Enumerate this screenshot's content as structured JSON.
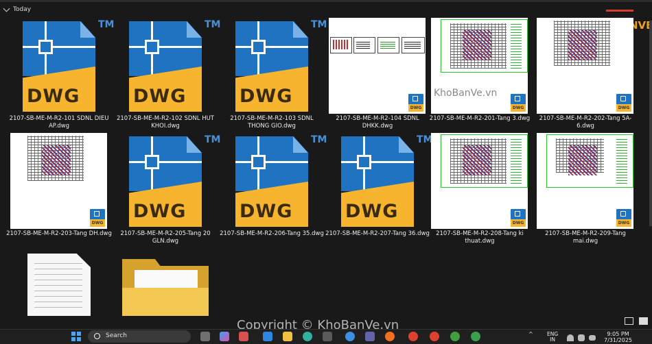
{
  "group": {
    "label": "Today"
  },
  "files": [
    {
      "name": "2107-SB-ME-M-R2-101 SDNL DIEU AP.dwg",
      "thumb": "dwg-icon"
    },
    {
      "name": "2107-SB-ME-M-R2-102 SDNL HUT KHOI.dwg",
      "thumb": "dwg-icon"
    },
    {
      "name": "2107-SB-ME-M-R2-103 SDNL THONG GIO.dwg",
      "thumb": "dwg-icon"
    },
    {
      "name": "2107-SB-ME-M-R2-104 SDNL DHKK.dwg",
      "thumb": "drawing"
    },
    {
      "name": "2107-SB-ME-M-R2-201-Tang 3.dwg",
      "thumb": "drawing"
    },
    {
      "name": "2107-SB-ME-M-R2-202-Tang 5A-6.dwg",
      "thumb": "drawing"
    },
    {
      "name": "2107-SB-ME-M-R2-203-Tang DH.dwg",
      "thumb": "drawing"
    },
    {
      "name": "2107-SB-ME-M-R2-205-Tang 20 GLN.dwg",
      "thumb": "dwg-icon"
    },
    {
      "name": "2107-SB-ME-M-R2-206-Tang 35.dwg",
      "thumb": "dwg-icon"
    },
    {
      "name": "2107-SB-ME-M-R2-207-Tang 36.dwg",
      "thumb": "dwg-icon"
    },
    {
      "name": "2107-SB-ME-M-R2-208-Tang ki thuat.dwg",
      "thumb": "drawing"
    },
    {
      "name": "2107-SB-ME-M-R2-209-Tang mai.dwg",
      "thumb": "drawing"
    }
  ],
  "icon_text": {
    "dwg": "DWG",
    "tm": "TM"
  },
  "watermark": {
    "logo": "KHOBANVE",
    "site": "KhoBanVe.vn",
    "copyright": "Copyright © KhoBanVe.vn"
  },
  "taskbar": {
    "search_placeholder": "Search",
    "lang_line1": "ENG",
    "lang_line2": "IN",
    "time": "9:05 PM",
    "date": "7/31/2025"
  },
  "colors": {
    "background": "#191919",
    "dwg_blue": "#1f73c0",
    "dwg_yellow": "#f6b42f",
    "folder": "#f3c852"
  }
}
